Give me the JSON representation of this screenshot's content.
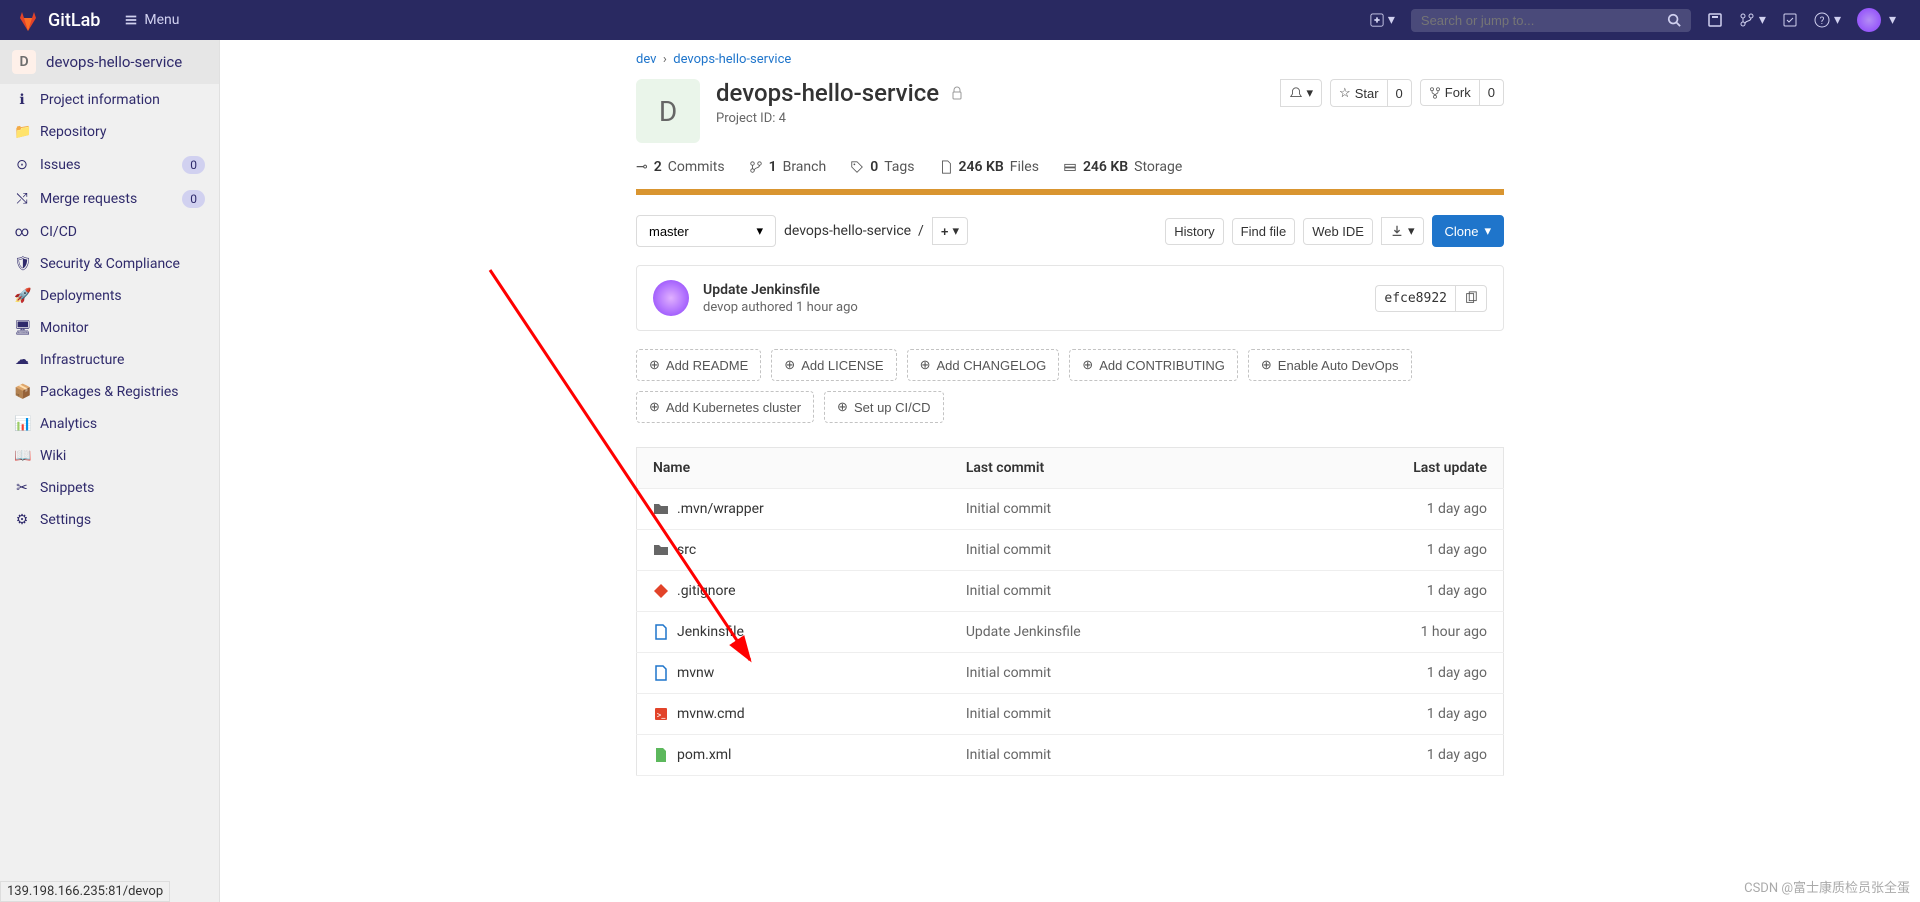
{
  "topbar": {
    "brand": "GitLab",
    "menu": "Menu",
    "search_placeholder": "Search or jump to..."
  },
  "sidebar": {
    "project_letter": "D",
    "project_name": "devops-hello-service",
    "items": [
      {
        "label": "Project information"
      },
      {
        "label": "Repository"
      },
      {
        "label": "Issues",
        "badge": "0"
      },
      {
        "label": "Merge requests",
        "badge": "0"
      },
      {
        "label": "CI/CD"
      },
      {
        "label": "Security & Compliance"
      },
      {
        "label": "Deployments"
      },
      {
        "label": "Monitor"
      },
      {
        "label": "Infrastructure"
      },
      {
        "label": "Packages & Registries"
      },
      {
        "label": "Analytics"
      },
      {
        "label": "Wiki"
      },
      {
        "label": "Snippets"
      },
      {
        "label": "Settings"
      }
    ]
  },
  "breadcrumb": {
    "group": "dev",
    "project": "devops-hello-service"
  },
  "project": {
    "letter": "D",
    "name": "devops-hello-service",
    "id_label": "Project ID: 4",
    "star_label": "Star",
    "star_count": "0",
    "fork_label": "Fork",
    "fork_count": "0"
  },
  "stats": {
    "commits_n": "2",
    "commits_l": "Commits",
    "branch_n": "1",
    "branch_l": "Branch",
    "tags_n": "0",
    "tags_l": "Tags",
    "files_n": "246 KB",
    "files_l": "Files",
    "storage_n": "246 KB",
    "storage_l": "Storage"
  },
  "controls": {
    "branch": "master",
    "path": "devops-hello-service",
    "history": "History",
    "find_file": "Find file",
    "web_ide": "Web IDE",
    "clone": "Clone"
  },
  "commit": {
    "message": "Update Jenkinsfile",
    "author": "devop",
    "authored": "authored",
    "when": "1 hour ago",
    "sha": "efce8922"
  },
  "quick_actions": [
    "Add README",
    "Add LICENSE",
    "Add CHANGELOG",
    "Add CONTRIBUTING",
    "Enable Auto DevOps",
    "Add Kubernetes cluster",
    "Set up CI/CD"
  ],
  "table": {
    "h_name": "Name",
    "h_commit": "Last commit",
    "h_update": "Last update",
    "rows": [
      {
        "icon": "folder",
        "name": ".mvn/wrapper",
        "commit": "Initial commit",
        "update": "1 day ago",
        "color": "#666"
      },
      {
        "icon": "folder",
        "name": "src",
        "commit": "Initial commit",
        "update": "1 day ago",
        "color": "#666"
      },
      {
        "icon": "git",
        "name": ".gitignore",
        "commit": "Initial commit",
        "update": "1 day ago",
        "color": "#e24329"
      },
      {
        "icon": "file",
        "name": "Jenkinsfile",
        "commit": "Update Jenkinsfile",
        "update": "1 hour ago",
        "color": "#1f75cb"
      },
      {
        "icon": "file",
        "name": "mvnw",
        "commit": "Initial commit",
        "update": "1 day ago",
        "color": "#1f75cb"
      },
      {
        "icon": "code",
        "name": "mvnw.cmd",
        "commit": "Initial commit",
        "update": "1 day ago",
        "color": "#e24329"
      },
      {
        "icon": "xml",
        "name": "pom.xml",
        "commit": "Initial commit",
        "update": "1 day ago",
        "color": "#5cb85c"
      }
    ]
  },
  "status_url": "139.198.166.235:81/devop",
  "watermark": "CSDN @富士康质检员张全蛋"
}
